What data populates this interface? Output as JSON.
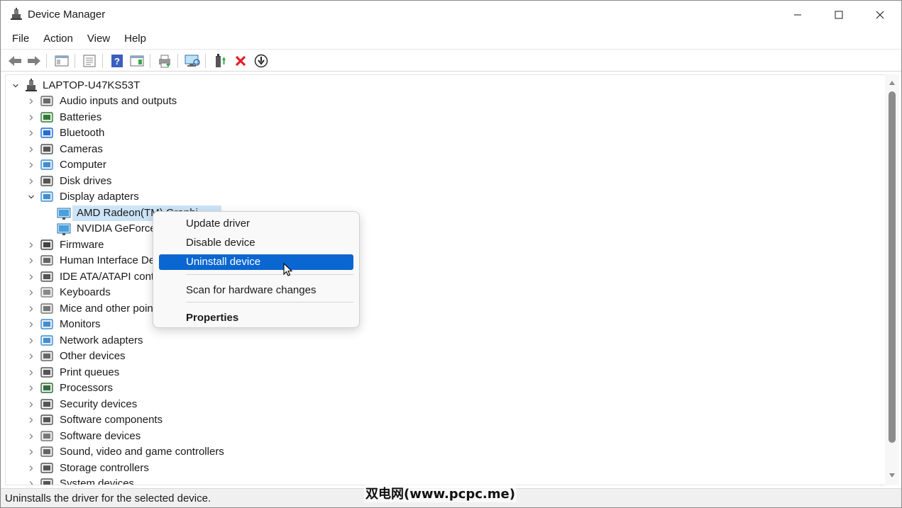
{
  "window": {
    "title": "Device Manager"
  },
  "menubar": {
    "items": [
      "File",
      "Action",
      "View",
      "Help"
    ]
  },
  "toolbar": {
    "buttons": [
      "back-icon",
      "forward-icon",
      "show-hide-console-tree-icon",
      "properties-icon",
      "help-icon",
      "action-pane-icon",
      "print-icon",
      "scan-hardware-icon",
      "update-driver-icon",
      "uninstall-icon",
      "disable-icon"
    ]
  },
  "tree": {
    "root": "LAPTOP-U47KS53T",
    "categories": [
      "Audio inputs and outputs",
      "Batteries",
      "Bluetooth",
      "Cameras",
      "Computer",
      "Disk drives",
      "Display adapters",
      "Firmware",
      "Human Interface Dev",
      "IDE ATA/ATAPI contro",
      "Keyboards",
      "Mice and other poin",
      "Monitors",
      "Network adapters",
      "Other devices",
      "Print queues",
      "Processors",
      "Security devices",
      "Software components",
      "Software devices",
      "Sound, video and game controllers",
      "Storage controllers",
      "System devices"
    ],
    "display_children": [
      "AMD Radeon(TM) Graphics",
      "NVIDIA GeForce"
    ],
    "display_children_visible": [
      "AMD Radeon(TM) Graphi",
      "NVIDIA GeForce"
    ]
  },
  "context_menu": {
    "items": [
      "Update driver",
      "Disable device",
      "Uninstall device",
      "Scan for hardware changes",
      "Properties"
    ],
    "highlighted": "Uninstall device"
  },
  "statusbar": {
    "text": "Uninstalls the driver for the selected device."
  },
  "watermark": "双电网(www.pcpc.me)",
  "colors": {
    "selection": "#cce4f7",
    "menu_highlight": "#0a66d0",
    "uninstall_red": "#e0202a"
  }
}
